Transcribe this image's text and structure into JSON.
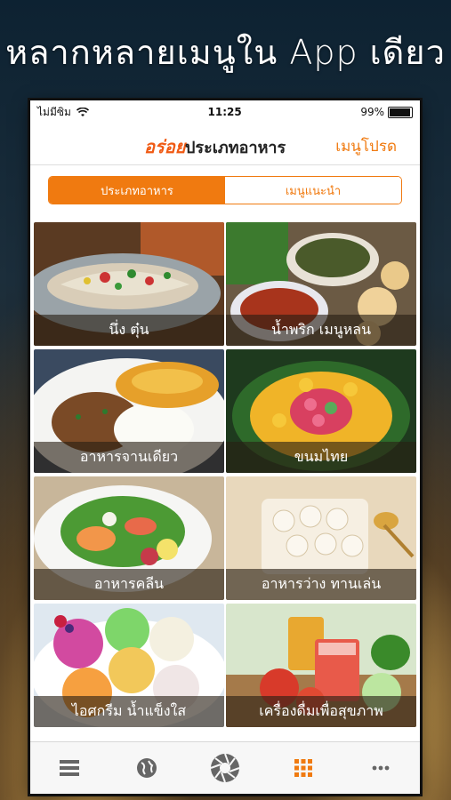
{
  "promo": {
    "headline": "หลากหลายเมนูใน App เดียว"
  },
  "status": {
    "carrier": "ไม่มีซิม",
    "time": "11:25",
    "battery": "99%"
  },
  "navbar": {
    "logo_text": "อร่อย",
    "logo_sub": "",
    "title": "ประเภทอาหาร",
    "right_action": "เมนูโปรด"
  },
  "segments": {
    "active": "ประเภทอาหาร",
    "inactive": "เมนูแนะนำ"
  },
  "categories": [
    {
      "label": "นึ่ง ตุ๋น"
    },
    {
      "label": "น้ำพริก เมนูหลน"
    },
    {
      "label": "อาหารจานเดียว"
    },
    {
      "label": "ขนมไทย"
    },
    {
      "label": "อาหารคลีน"
    },
    {
      "label": "อาหารว่าง ทานเล่น"
    },
    {
      "label": "ไอศกรีม น้ำแข็งใส"
    },
    {
      "label": "เครื่องดื่มเพื่อสุขภาพ"
    }
  ],
  "tabbar": {
    "tabs": [
      {
        "icon": "list-icon",
        "active": false
      },
      {
        "icon": "globe-icon",
        "active": false
      },
      {
        "icon": "camera-aperture-icon",
        "active": false
      },
      {
        "icon": "grid-icon",
        "active": true
      },
      {
        "icon": "more-icon",
        "active": false
      }
    ]
  },
  "colors": {
    "accent": "#f07a10",
    "logo": "#f05a14",
    "caption_bg": "#281e14"
  }
}
